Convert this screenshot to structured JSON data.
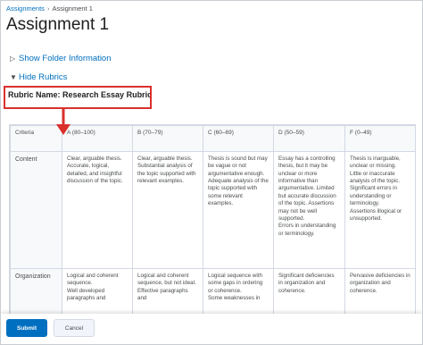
{
  "breadcrumb": {
    "link": "Assignments",
    "current": "Assignment 1"
  },
  "page_title": "Assignment 1",
  "folder_toggle": "Show Folder Information",
  "rubric_toggle": "Hide Rubrics",
  "rubric_name": "Rubric Name: Research Essay Rubric",
  "colors": {
    "link": "#006fbf",
    "highlight": "#d9302c",
    "primary_button": "#006fbf"
  },
  "table": {
    "headers": [
      "Criteria",
      "A (80–100)",
      "B (70–79)",
      "C (60–69)",
      "D (50–59)",
      "F (0–49)"
    ],
    "rows": [
      {
        "criteria": "Content",
        "cells": [
          "Clear, arguable thesis.\nAccurate, logical, detailed, and insightful discussion of the topic.",
          "Clear, arguable thesis.\nSubstantial analysis of the topic supported with relevant examples.",
          "Thesis is sound but may be vague or not argumentative enough.\nAdequate analysis of the topic supported with some relevant examples.",
          "Essay has a controlling thesis, but it may be unclear or more informative than argumentative. Limited but accurate discussion of the topic. Assertions may not be well supported.\nErrors in understanding or terminology.",
          "Thesis is inarguable, unclear or missing.\nLittle or inaccurate analysis of the topic. Significant errors in understanding or terminology.\nAssertions illogical or unsupported."
        ]
      },
      {
        "criteria": "Organization",
        "cells": [
          "Logical and coherent sequence.\nWell developed paragraphs and",
          "Logical and coherent sequence, but not ideal.\nEffective paragraphs and",
          "Logical sequence with some gaps in ordering or coherence.\nSome weaknesses in",
          "Significant deficiencies in organization and coherence.",
          "Pervasive deficiencies in organization and coherence."
        ]
      }
    ]
  },
  "footer": {
    "submit": "Submit",
    "cancel": "Cancel"
  }
}
